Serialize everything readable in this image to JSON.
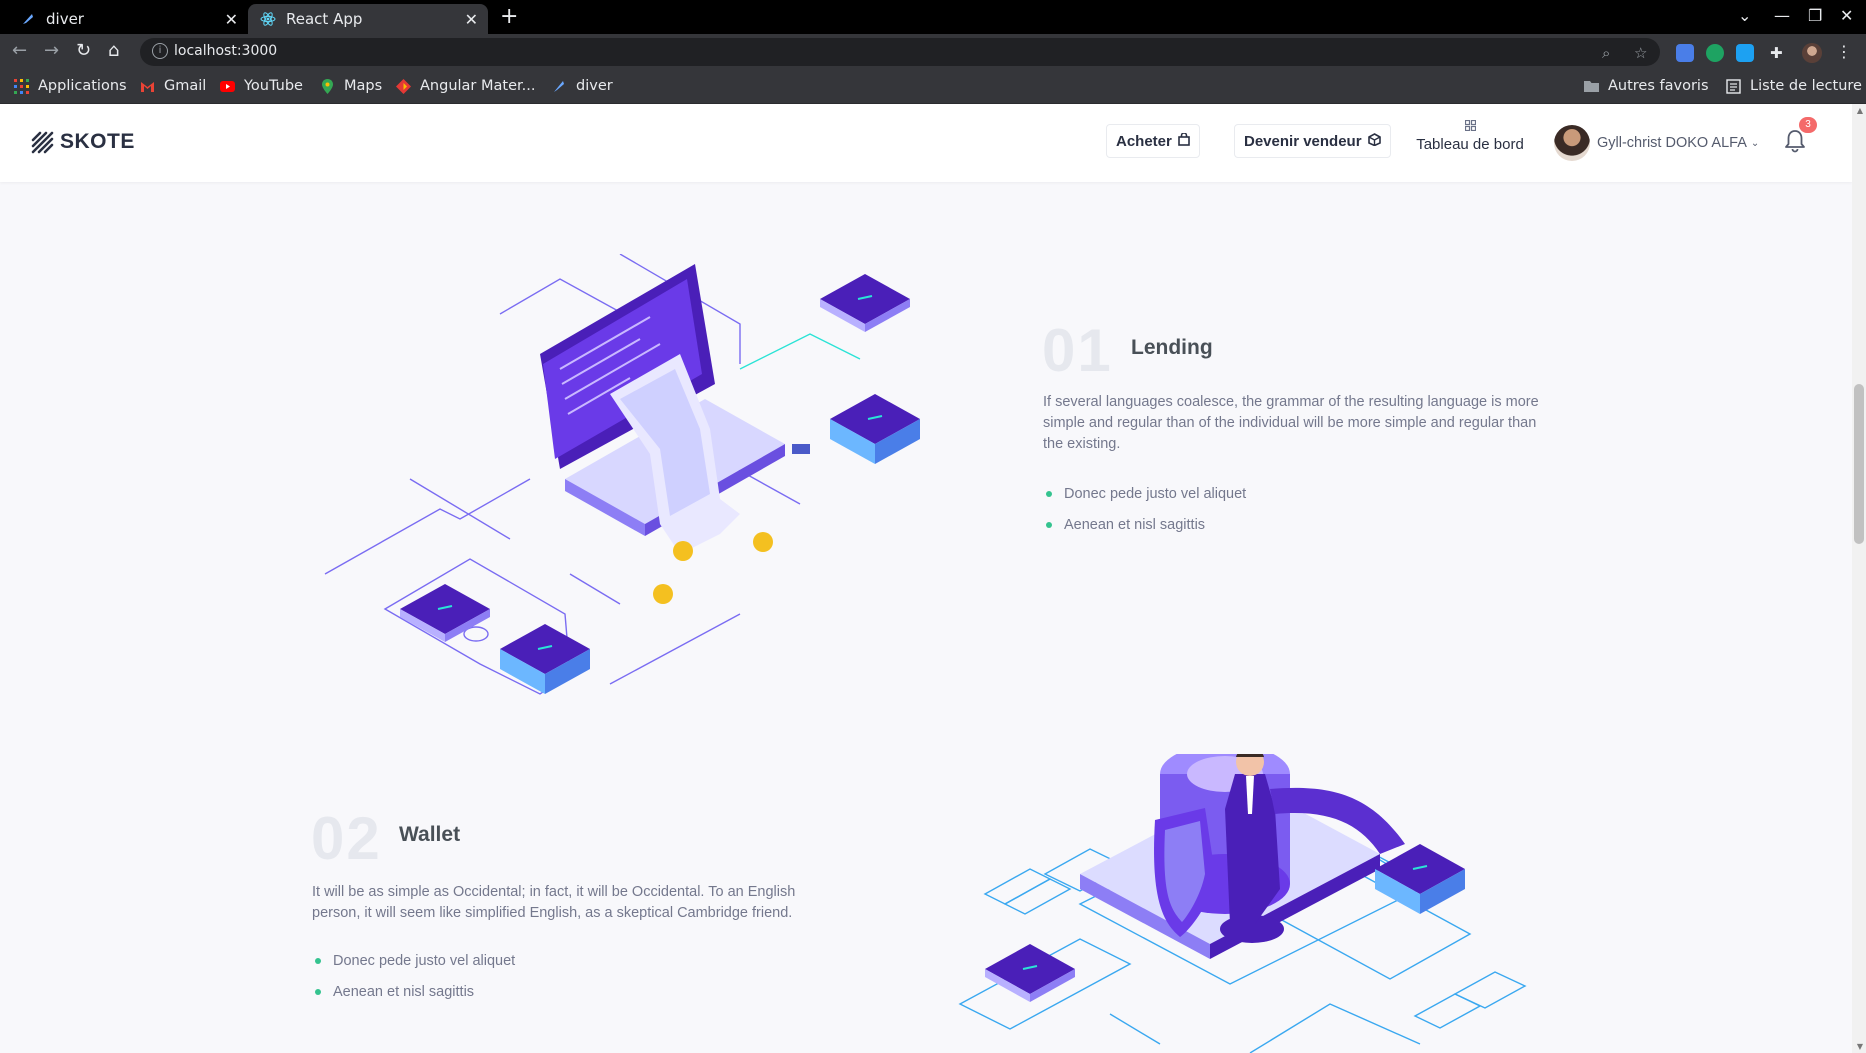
{
  "browser": {
    "tabs": [
      {
        "title": "diver",
        "active": false
      },
      {
        "title": "React App",
        "active": true
      }
    ],
    "url": "localhost:3000",
    "bookmarks": [
      "Applications",
      "Gmail",
      "YouTube",
      "Maps",
      "Angular Mater...",
      "diver"
    ],
    "bookmarks_right": [
      "Autres favoris",
      "Liste de lecture"
    ]
  },
  "header": {
    "logo_text": "SKOTE",
    "buy_label": "Acheter",
    "seller_label": "Devenir vendeur",
    "dashboard_label": "Tableau de bord",
    "user_name": "Gyll-christ DOKO ALFA",
    "notification_count": "3"
  },
  "features": [
    {
      "number": "01",
      "title": "Lending",
      "text": "If several languages coalesce, the grammar of the resulting language is more simple and regular than of the individual will be more simple and regular than the existing.",
      "items": [
        "Donec pede justo vel aliquet",
        "Aenean et nisl sagittis"
      ]
    },
    {
      "number": "02",
      "title": "Wallet",
      "text": "It will be as simple as Occidental; in fact, it will be Occidental. To an English person, it will seem like simplified English, as a skeptical Cambridge friend.",
      "items": [
        "Donec pede justo vel aliquet",
        "Aenean et nisl sagittis"
      ]
    }
  ],
  "colors": {
    "accent": "#556ee6",
    "success": "#34c38f",
    "danger": "#f46a6a",
    "illustration_primary": "#4a1fb8",
    "illustration_line": "#6a5df0"
  }
}
